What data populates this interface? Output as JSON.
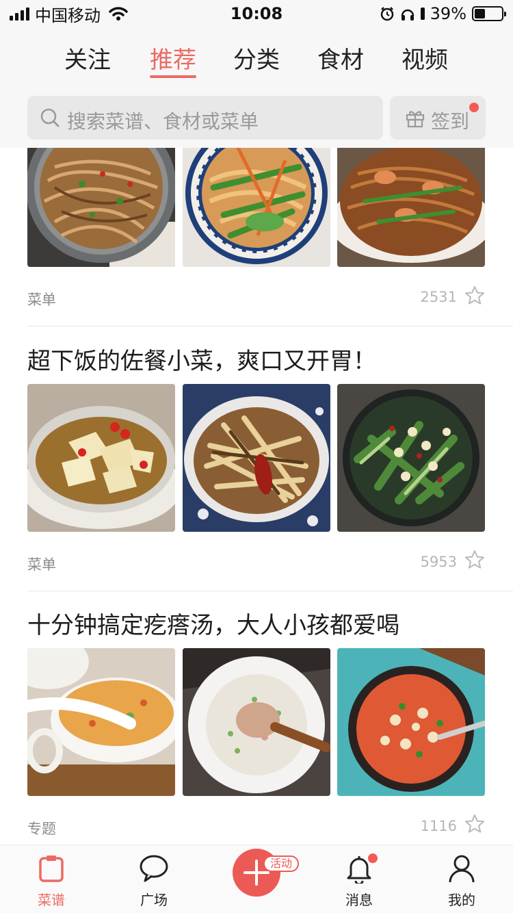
{
  "status_bar": {
    "carrier": "中国移动",
    "time": "10:08",
    "battery": "39%"
  },
  "tabs": [
    {
      "label": "关注"
    },
    {
      "label": "推荐",
      "active": true
    },
    {
      "label": "分类"
    },
    {
      "label": "食材"
    },
    {
      "label": "视频"
    }
  ],
  "search": {
    "placeholder": "搜索菜谱、食材或菜单",
    "checkin_label": "签到"
  },
  "cards": [
    {
      "title": "",
      "images": [
        "stir-fried noodles in gray bowl",
        "fried noodles with greens on blue plate",
        "shrimp noodles with vegetables"
      ],
      "type": "菜单",
      "count": "2531"
    },
    {
      "title": "超下饭的佐餐小菜，爽口又开胃！",
      "images": [
        "pickled radish with red chilies",
        "braised king oyster mushrooms with dried chilies",
        "smashed cucumber salad with garlic"
      ],
      "type": "菜单",
      "count": "5953"
    },
    {
      "title": "十分钟搞定疙瘩汤，大人小孩都爱喝",
      "images": [
        "tomato dough drop soup in cup",
        "white dough drop soup with wooden spoon",
        "tomato dough drop soup in dark bowl"
      ],
      "type": "专题",
      "count": "1116"
    }
  ],
  "bottom_nav": [
    {
      "label": "菜谱",
      "icon": "recipe-book-icon",
      "active": true
    },
    {
      "label": "广场",
      "icon": "chat-bubble-icon"
    },
    {
      "label": "",
      "icon": "plus-icon"
    },
    {
      "label": "消息",
      "icon": "bell-icon"
    },
    {
      "label": "我的",
      "icon": "profile-icon"
    }
  ],
  "activity_badge": "活动",
  "colors": {
    "accent": "#ec6a63",
    "background": "#f7f7f7",
    "badge": "#f45a55"
  }
}
